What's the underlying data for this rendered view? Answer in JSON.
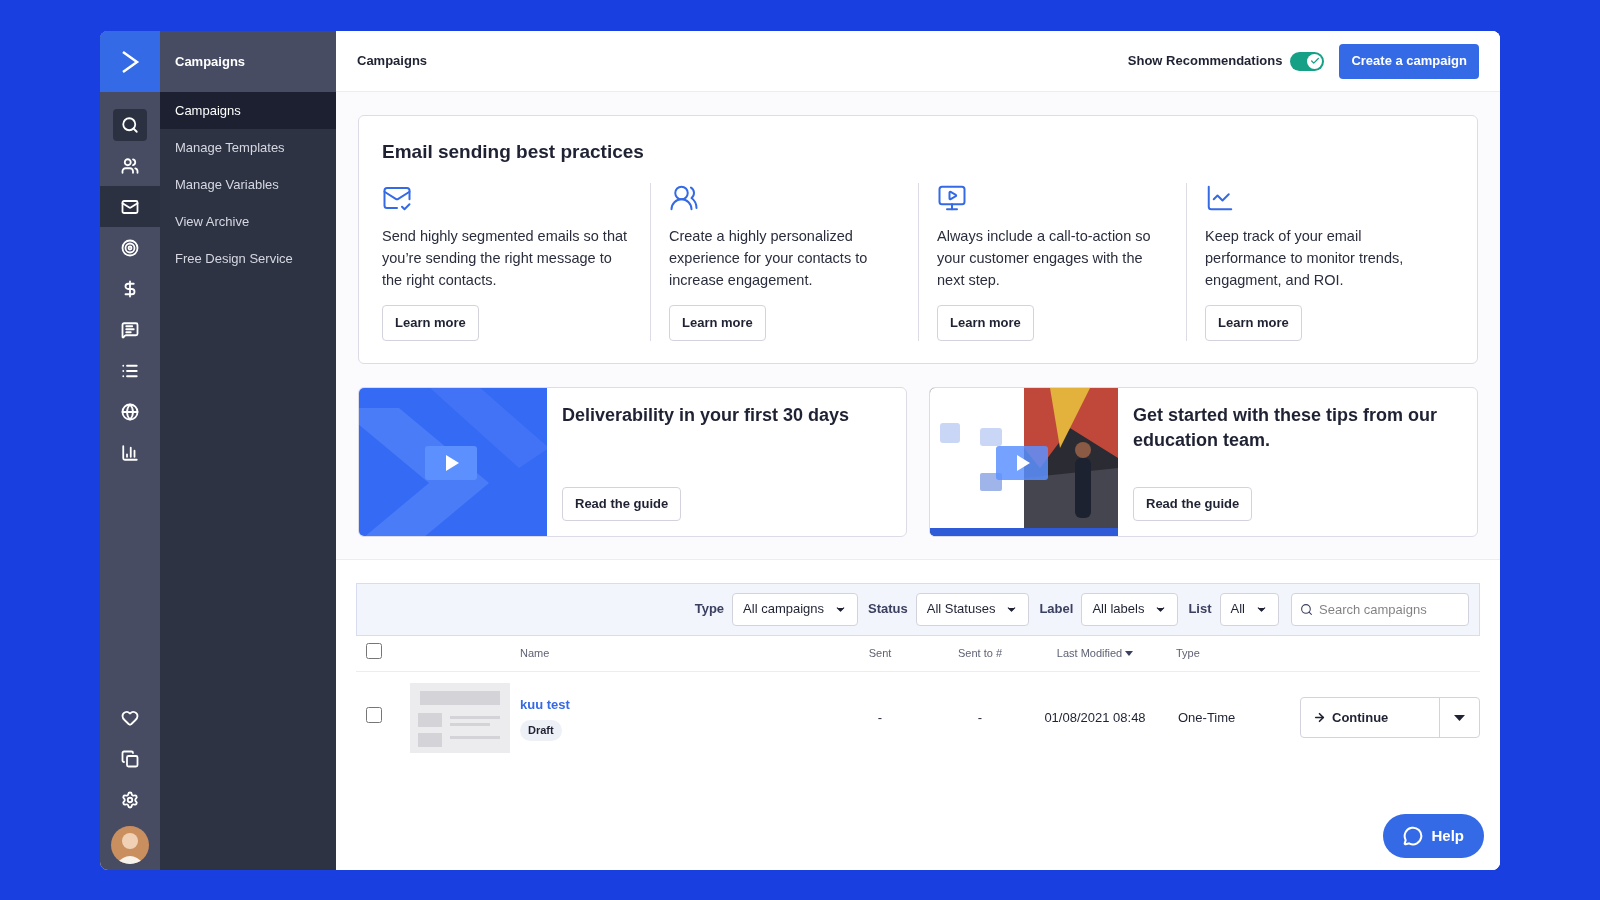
{
  "rail": {
    "items": [
      {
        "selected": false
      },
      {
        "selected": false
      },
      {
        "selected": true
      },
      {
        "selected": false
      },
      {
        "selected": false
      },
      {
        "selected": false
      },
      {
        "selected": false
      },
      {
        "selected": false
      },
      {
        "selected": false
      }
    ],
    "bottom_items": [
      {
        "selected": false
      },
      {
        "selected": false
      },
      {
        "selected": false
      }
    ]
  },
  "submenu": {
    "title": "Campaigns",
    "items": [
      {
        "label": "Campaigns",
        "selected": true
      },
      {
        "label": "Manage Templates",
        "selected": false
      },
      {
        "label": "Manage Variables",
        "selected": false
      },
      {
        "label": "View Archive",
        "selected": false
      },
      {
        "label": "Free Design Service",
        "selected": false
      }
    ]
  },
  "header": {
    "title": "Campaigns",
    "toggle": {
      "label": "Show Recommendations",
      "on": true
    },
    "button": "Create a campaign"
  },
  "best_practices": {
    "title": "Email sending best practices",
    "tips": [
      {
        "text": "Send highly segmented emails so that you’re sending the right message to the right contacts.",
        "button": "Learn more"
      },
      {
        "text": "Create a highly personalized experience for your contacts to increase engagement.",
        "button": "Learn more"
      },
      {
        "text": "Always include a call-to-action so your customer engages with the next step.",
        "button": "Learn more"
      },
      {
        "text": "Keep track of your email performance to monitor trends, engagment, and ROI.",
        "button": "Learn more"
      }
    ]
  },
  "guides": [
    {
      "title": "Deliverability in your first 30 days",
      "button": "Read the guide",
      "kind": "picture"
    },
    {
      "title": "Get started with these tips from our education team.",
      "button": "Read the guide",
      "kind": "picture"
    }
  ],
  "filters": {
    "items": [
      {
        "label": "Type",
        "value": "All campaigns"
      },
      {
        "label": "Status",
        "value": "All Statuses"
      },
      {
        "label": "Label",
        "value": "All labels"
      },
      {
        "label": "List",
        "value": "All"
      }
    ],
    "search": {
      "placeholder": "Search campaigns"
    }
  },
  "table": {
    "select_all": {
      "checked": false
    },
    "columns": [
      {
        "label": "Name",
        "sorted": false
      },
      {
        "label": "Sent",
        "sorted": false
      },
      {
        "label": "Sent to #",
        "sorted": false
      },
      {
        "label": "Last Modified",
        "sorted": true
      },
      {
        "label": "Type",
        "sorted": false
      }
    ],
    "rows": [
      {
        "checked": false,
        "name": "kuu test",
        "status": "Draft",
        "sent": "-",
        "sent_to": "-",
        "modified": "01/08/2021 08:48",
        "type": "One-Time",
        "action": "Continue"
      }
    ]
  },
  "help": "Help"
}
